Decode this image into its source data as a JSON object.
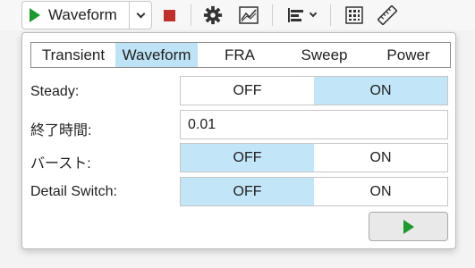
{
  "toolbar": {
    "run_label": "Waveform",
    "icons": [
      "play-icon",
      "chevron-down-icon",
      "stop-icon",
      "gear-icon",
      "waveform-view-icon",
      "align-icon",
      "grid-icon",
      "ruler-icon"
    ],
    "colors": {
      "play": "#1c9a2c",
      "stop": "#c0302a"
    }
  },
  "tabs": [
    {
      "label": "Transient"
    },
    {
      "label": "Waveform"
    },
    {
      "label": "FRA"
    },
    {
      "label": "Sweep"
    },
    {
      "label": "Power"
    }
  ],
  "active_tab": "Waveform",
  "rows": {
    "steady": {
      "label": "Steady:",
      "off": "OFF",
      "on": "ON",
      "selected": "ON"
    },
    "end_time": {
      "label": "終了時間:",
      "value": "0.01"
    },
    "burst": {
      "label": "バースト:",
      "off": "OFF",
      "on": "ON",
      "selected": "OFF"
    },
    "detail_switch": {
      "label": "Detail Switch:",
      "off": "OFF",
      "on": "ON",
      "selected": "OFF"
    }
  },
  "colors": {
    "selected_bg": "#c3e5f8",
    "active_tab_bg": "#bfe3f6"
  }
}
